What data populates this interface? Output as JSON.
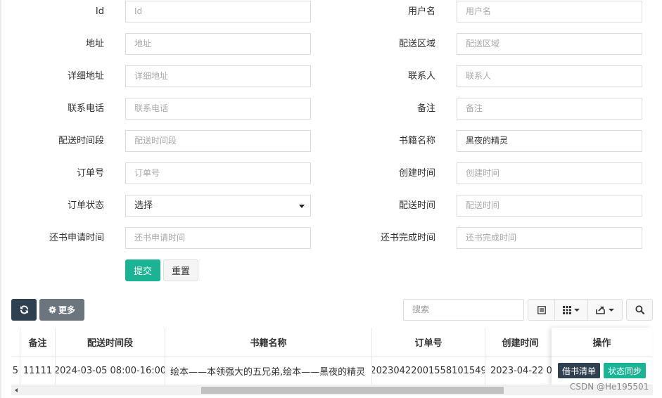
{
  "form": {
    "rows": [
      {
        "left": {
          "label": "Id",
          "placeholder": "Id",
          "value": ""
        },
        "right": {
          "label": "用户名",
          "placeholder": "用户名",
          "value": ""
        }
      },
      {
        "left": {
          "label": "地址",
          "placeholder": "地址",
          "value": ""
        },
        "right": {
          "label": "配送区域",
          "placeholder": "配送区域",
          "value": ""
        }
      },
      {
        "left": {
          "label": "详细地址",
          "placeholder": "详细地址",
          "value": ""
        },
        "right": {
          "label": "联系人",
          "placeholder": "联系人",
          "value": ""
        }
      },
      {
        "left": {
          "label": "联系电话",
          "placeholder": "联系电话",
          "value": ""
        },
        "right": {
          "label": "备注",
          "placeholder": "备注",
          "value": ""
        }
      },
      {
        "left": {
          "label": "配送时间段",
          "placeholder": "配送时间段",
          "value": ""
        },
        "right": {
          "label": "书籍名称",
          "placeholder": "书籍名称",
          "value": "黑夜的精灵"
        }
      },
      {
        "left": {
          "label": "订单号",
          "placeholder": "订单号",
          "value": ""
        },
        "right": {
          "label": "创建时间",
          "placeholder": "创建时间",
          "value": ""
        }
      },
      {
        "left": {
          "label": "订单状态",
          "selected": "选择"
        },
        "right": {
          "label": "配送时间",
          "placeholder": "配送时间",
          "value": ""
        }
      },
      {
        "left": {
          "label": "还书申请时间",
          "placeholder": "还书申请时间",
          "value": ""
        },
        "right": {
          "label": "还书完成时间",
          "placeholder": "还书完成时间",
          "value": ""
        }
      }
    ],
    "submit_label": "提交",
    "reset_label": "重置"
  },
  "toolbar": {
    "refresh_icon": "refresh-icon",
    "more_icon": "gear-icon",
    "more_label": "更多",
    "search_placeholder": "搜索",
    "list_icon": "list-icon",
    "columns_icon": "grid-icon",
    "export_icon": "export-icon",
    "find_icon": "search-icon"
  },
  "table": {
    "columns": [
      "备注",
      "配送时间段",
      "书籍名称",
      "订单号",
      "创建时间"
    ],
    "row": {
      "cut_value": "5",
      "note": "11111",
      "time_slot": "2024-03-05 08:00-16:00",
      "books": "绘本——本领强大的五兄弟,绘本——黑夜的精灵",
      "order_no": "20230422001558101549",
      "created": "2023-04-22 00"
    },
    "fixed": {
      "header": "操作",
      "borrow_label": "借书清单",
      "sync_label": "状态同步"
    }
  },
  "watermark": "CSDN @He195501",
  "colors": {
    "primary_green": "#1ab394",
    "dark_navy": "#2f4050",
    "gray_button": "#6c757d"
  }
}
